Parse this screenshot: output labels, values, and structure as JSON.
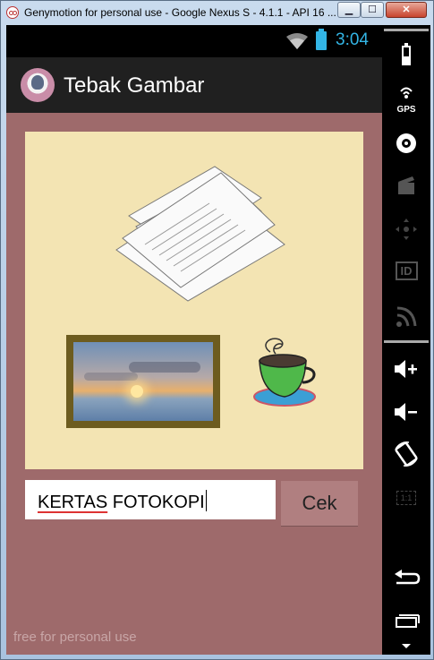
{
  "window": {
    "title": "Genymotion for personal use - Google Nexus S - 4.1.1 - API 16 ...",
    "minimize_label": "▁",
    "maximize_label": "☐",
    "close_label": "✕"
  },
  "statusbar": {
    "time": "3:04",
    "icons": [
      "wifi-icon",
      "battery-icon"
    ]
  },
  "app": {
    "title": "Tebak Gambar",
    "logo_icon": "app-logo-icon"
  },
  "puzzle": {
    "images": [
      "paper-stack-icon",
      "picture-frame-icon",
      "coffee-cup-icon"
    ]
  },
  "answer": {
    "word1": "KERTAS",
    "word2": "FOTOKOPI"
  },
  "check_button": {
    "label": "Cek"
  },
  "watermark": "free for personal use",
  "side_buttons": {
    "gps_label": "GPS",
    "id_label": "ID",
    "scale_label": "1:1",
    "icons": [
      "battery-icon",
      "gps-icon",
      "camera-icon",
      "clapper-icon",
      "dpad-icon",
      "id-icon",
      "rss-icon",
      "volume-up-icon",
      "volume-down-icon",
      "rotate-icon",
      "scale-icon",
      "back-icon",
      "recent-apps-icon",
      "more-arrow-icon"
    ]
  },
  "colors": {
    "content_bg": "#9e6a6b",
    "panel_bg": "#f3e4b3",
    "accent_blue": "#33b5e5",
    "actionbar_bg": "#202020",
    "button_bg": "#b07f80"
  }
}
